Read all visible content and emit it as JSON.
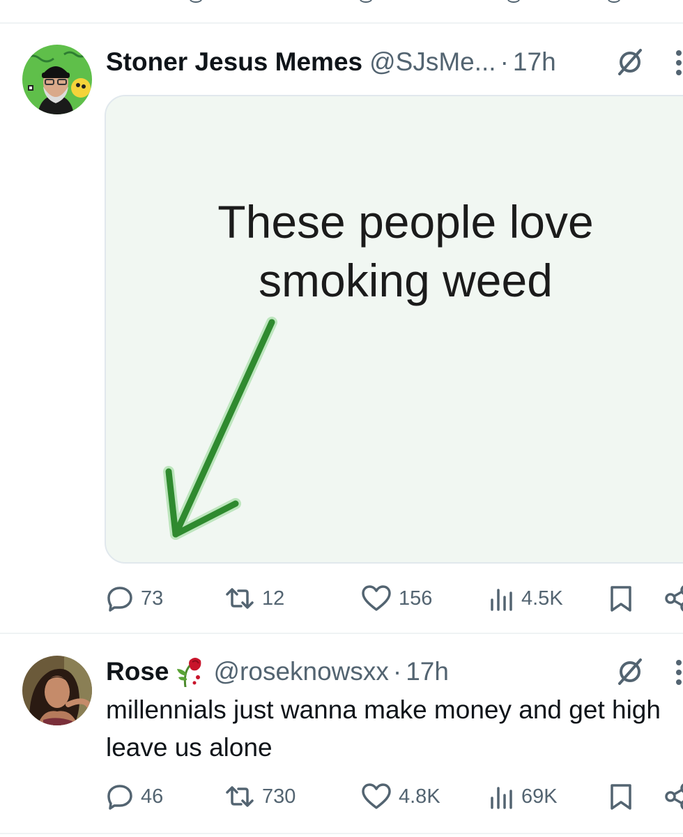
{
  "posts": [
    {
      "author": {
        "display_name": "Stoner Jesus Memes",
        "handle": "@SJsMe...",
        "time": "17h",
        "avatar_icon": "avatar-bearded-man-icon"
      },
      "media": {
        "text_line1": "These people love",
        "text_line2": "smoking weed",
        "arrow_color": "#2f8a2f"
      },
      "actions": {
        "replies": "73",
        "reposts": "12",
        "likes": "156",
        "views": "4.5K"
      }
    },
    {
      "author": {
        "display_name": "Rose",
        "emoji_icon": "wilted-rose-icon",
        "handle": "@roseknowsxx",
        "time": "17h",
        "avatar_icon": "avatar-woman-icon"
      },
      "text": "millennials just wanna make money and get high leave us alone",
      "actions": {
        "replies": "46",
        "reposts": "730",
        "likes": "4.8K",
        "views": "69K"
      }
    }
  ],
  "colors": {
    "text_primary": "#0f1419",
    "text_secondary": "#536471",
    "divider": "#eff3f4",
    "media_bg": "#f1f7f2"
  }
}
